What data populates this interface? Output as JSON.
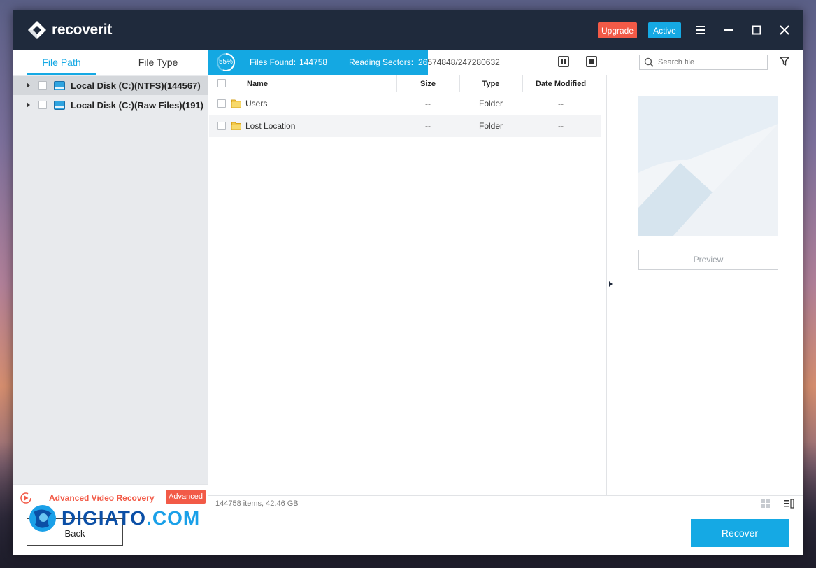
{
  "app": {
    "name": "recoverit"
  },
  "titlebar": {
    "upgrade_label": "Upgrade",
    "active_label": "Active",
    "menu_icon": "hamburger-menu-icon",
    "minimize_icon": "minimize-icon",
    "maximize_icon": "maximize-icon",
    "close_icon": "close-icon"
  },
  "left_panel": {
    "tabs": [
      {
        "label": "File Path",
        "active": true
      },
      {
        "label": "File Type",
        "active": false
      }
    ],
    "tree": [
      {
        "label": "Local Disk (C:)(NTFS)(144567)",
        "selected": true
      },
      {
        "label": "Local Disk (C:)(Raw Files)(191)",
        "selected": false
      }
    ],
    "advanced_video": {
      "label": "Advanced Video Recovery",
      "badge": "Advanced"
    }
  },
  "scan": {
    "percent_label": "55%",
    "percent": 55,
    "files_found_label": "Files Found:",
    "files_found_value": "144758",
    "reading_sectors_label": "Reading Sectors:",
    "reading_sectors_value": "26574848/247280632"
  },
  "search": {
    "placeholder": "Search file"
  },
  "table": {
    "columns": [
      "Name",
      "Size",
      "Type",
      "Date Modified"
    ],
    "rows": [
      {
        "name": "Users",
        "size": "--",
        "type": "Folder",
        "date": "--"
      },
      {
        "name": "Lost Location",
        "size": "--",
        "type": "Folder",
        "date": "--"
      }
    ]
  },
  "preview": {
    "button_label": "Preview"
  },
  "status": {
    "summary": "144758 items, 42.46  GB"
  },
  "footer": {
    "back_label": "Back",
    "recover_label": "Recover"
  },
  "watermark": {
    "text_main": "DIGIATO",
    "text_tld": ".COM"
  },
  "colors": {
    "accent": "#15a9e4",
    "upgrade": "#f25a47",
    "titlebar": "#1f2a3c"
  }
}
